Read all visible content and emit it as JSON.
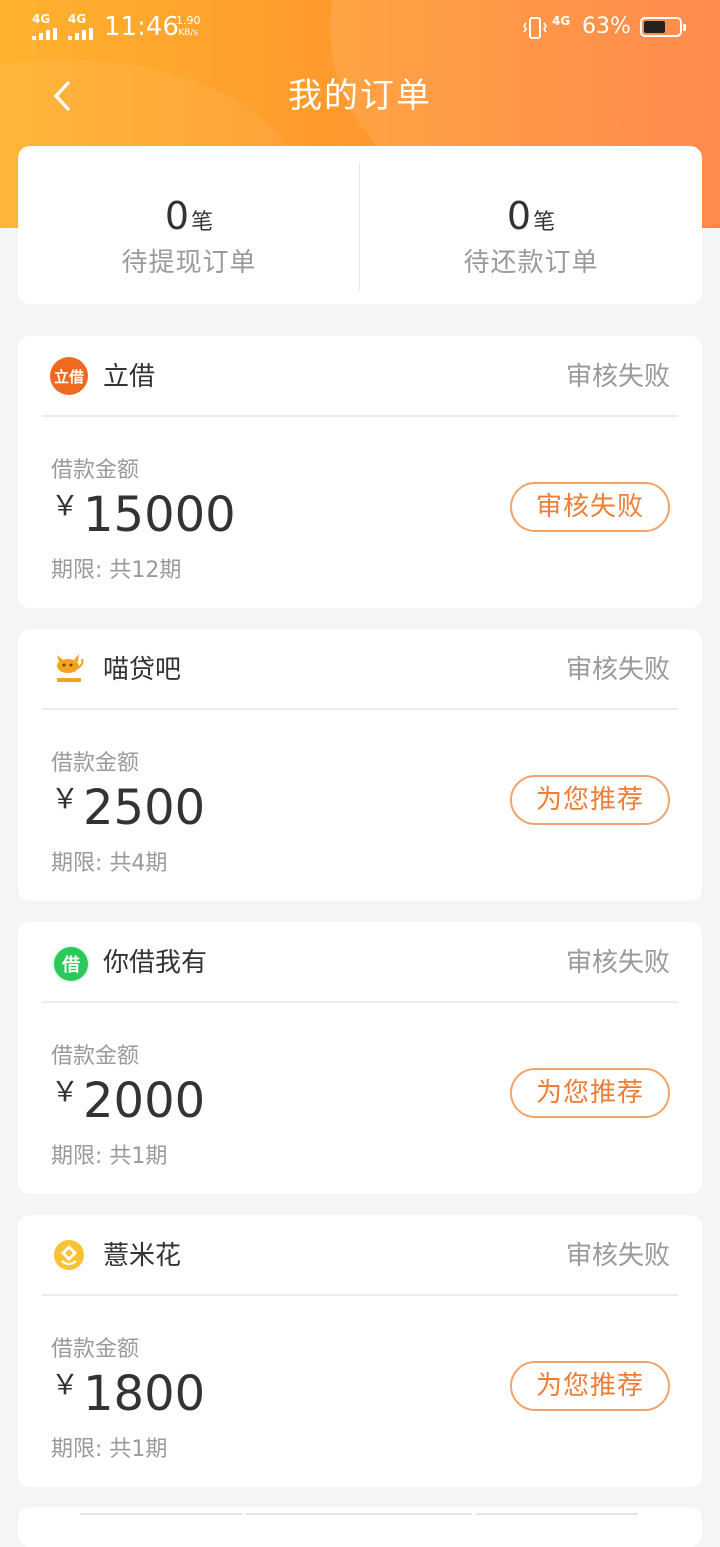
{
  "status_bar": {
    "network_1": "4G",
    "network_2": "4G",
    "time": "11:46",
    "speed_value": "1.90",
    "speed_unit": "KB/s",
    "network_3": "4G",
    "battery_percent": "63%",
    "battery_level": 0.63
  },
  "header": {
    "title": "我的订单",
    "back_icon": "chevron-left-icon"
  },
  "summary": {
    "left": {
      "count": "0",
      "unit": "笔",
      "label": "待提现订单"
    },
    "right": {
      "count": "0",
      "unit": "笔",
      "label": "待还款订单"
    }
  },
  "orders": [
    {
      "name": "立借",
      "logo_icon": "lijie-logo-icon",
      "logo_text": "立借",
      "status": "审核失败",
      "amount_label": "借款金额",
      "currency": "￥",
      "amount": "15000",
      "term": "期限: 共12期",
      "action": "审核失败"
    },
    {
      "name": "喵贷吧",
      "logo_icon": "cat-logo-icon",
      "logo_text": "",
      "status": "审核失败",
      "amount_label": "借款金额",
      "currency": "￥",
      "amount": "2500",
      "term": "期限: 共4期",
      "action": "为您推荐"
    },
    {
      "name": "你借我有",
      "logo_icon": "nijiewoyou-logo-icon",
      "logo_text": "借",
      "status": "审核失败",
      "amount_label": "借款金额",
      "currency": "￥",
      "amount": "2000",
      "term": "期限: 共1期",
      "action": "为您推荐"
    },
    {
      "name": "薏米花",
      "logo_icon": "yimihua-logo-icon",
      "logo_text": "",
      "status": "审核失败",
      "amount_label": "借款金额",
      "currency": "￥",
      "amount": "1800",
      "term": "期限: 共1期",
      "action": "为您推荐"
    }
  ],
  "colors": {
    "header_gradient_start": "#ffb22e",
    "header_gradient_end": "#ff7e3a",
    "accent_orange": "#ee7d36",
    "button_border": "#f1a36a",
    "muted_text": "#9a9a9a",
    "page_background": "#f4f5f7"
  }
}
